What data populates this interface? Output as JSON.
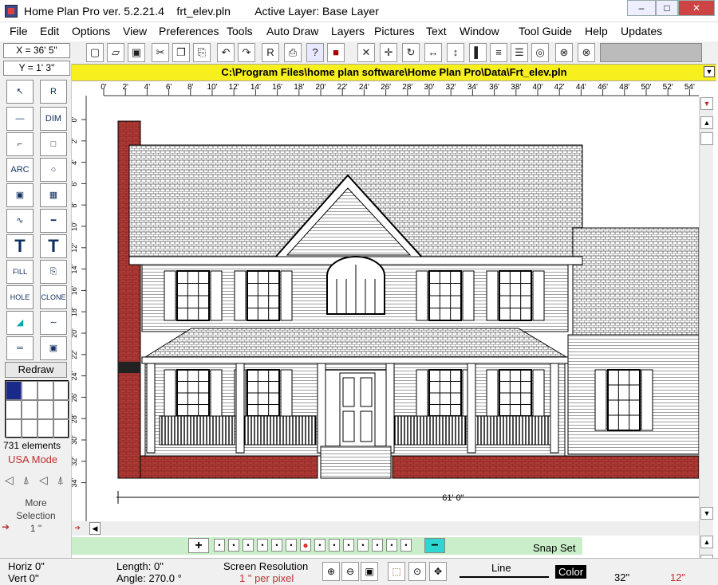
{
  "titlebar": {
    "title": "Home Plan Pro ver. 5.2.21.4    frt_elev.pln        Active Layer: Base Layer",
    "buttons": [
      "–",
      "□",
      "✕"
    ]
  },
  "menu": [
    "File",
    "Edit",
    "Options",
    "View",
    "Preferences",
    "Tools",
    "Auto Draw",
    "Layers",
    "Pictures",
    "Text",
    "Window",
    "Tool Guide",
    "Help",
    "Updates"
  ],
  "coords": {
    "x": "X = 36' 5\"",
    "y": "Y = 1' 3\""
  },
  "toolbar_icons": [
    "new-icon",
    "open-icon",
    "save-icon",
    "cut-icon",
    "copy-icon",
    "paste-icon",
    "undo-icon",
    "redo-icon",
    "r-icon",
    "print-icon",
    "help-icon",
    "color-icon",
    "delete-icon",
    "move-icon",
    "rotate-icon",
    "dimension-icon",
    "line-icon",
    "door-icon",
    "window-icon",
    "wall-icon",
    "orbit-icon",
    "arch-icon"
  ],
  "toolbar_glyphs": [
    "▢",
    "▱",
    "▣",
    "✂",
    "❐",
    "⎘",
    "↶",
    "↷",
    "R",
    "⎙",
    "?",
    "■",
    "✕",
    "✛",
    "↻",
    "↔",
    "↕",
    "▌",
    "≡",
    "☰",
    "◎",
    "⊗"
  ],
  "path": "C:\\Program Files\\home plan software\\Home Plan Pro\\Data\\Frt_elev.pln",
  "ruler_top": [
    "0'",
    "2'",
    "4'",
    "6'",
    "8'",
    "10'",
    "12'",
    "14'",
    "16'",
    "18'",
    "20'",
    "22'",
    "24'",
    "26'",
    "28'",
    "30'",
    "32'",
    "34'",
    "36'",
    "38'",
    "40'",
    "42'",
    "44'",
    "46'",
    "48'",
    "50'",
    "52'",
    "54'"
  ],
  "ruler_left": [
    "0'",
    "2'",
    "4'",
    "6'",
    "8'",
    "10'",
    "12'",
    "14'",
    "16'",
    "18'",
    "20'",
    "22'",
    "24'",
    "26'",
    "28'",
    "30'",
    "32'",
    "34'"
  ],
  "tools": {
    "labels": [
      "↖",
      "R",
      "—",
      "DIM",
      "⌐",
      "□",
      "ARC",
      "○",
      "▣",
      "▦",
      "∿",
      "━",
      "T",
      "T",
      "FILL",
      "⎘",
      "HOLE",
      "CLONE",
      "◢",
      "∼",
      "═",
      "▣"
    ],
    "redraw": "Redraw",
    "elements": "731 elements",
    "mode": "USA Mode",
    "more": "More",
    "selection": "Selection",
    "sel_value": "1 \""
  },
  "dimension_label": "61' 0\"",
  "bottom": {
    "snap": "Snap Set",
    "horiz": "Horiz 0\"",
    "vert": "Vert 0\"",
    "length": "Length: 0\"",
    "angle": "Angle: 270.0 °",
    "res_title": "Screen Resolution",
    "res_value": "1 \" per pixel",
    "line": "Line",
    "color": "Color",
    "val1": "32\"",
    "val2": "12\""
  },
  "colors": {
    "brick": "#b03a35",
    "path_bar": "#f8ef1f",
    "nav_bar": "#c9eec9",
    "accent": "#2fd5d0"
  }
}
